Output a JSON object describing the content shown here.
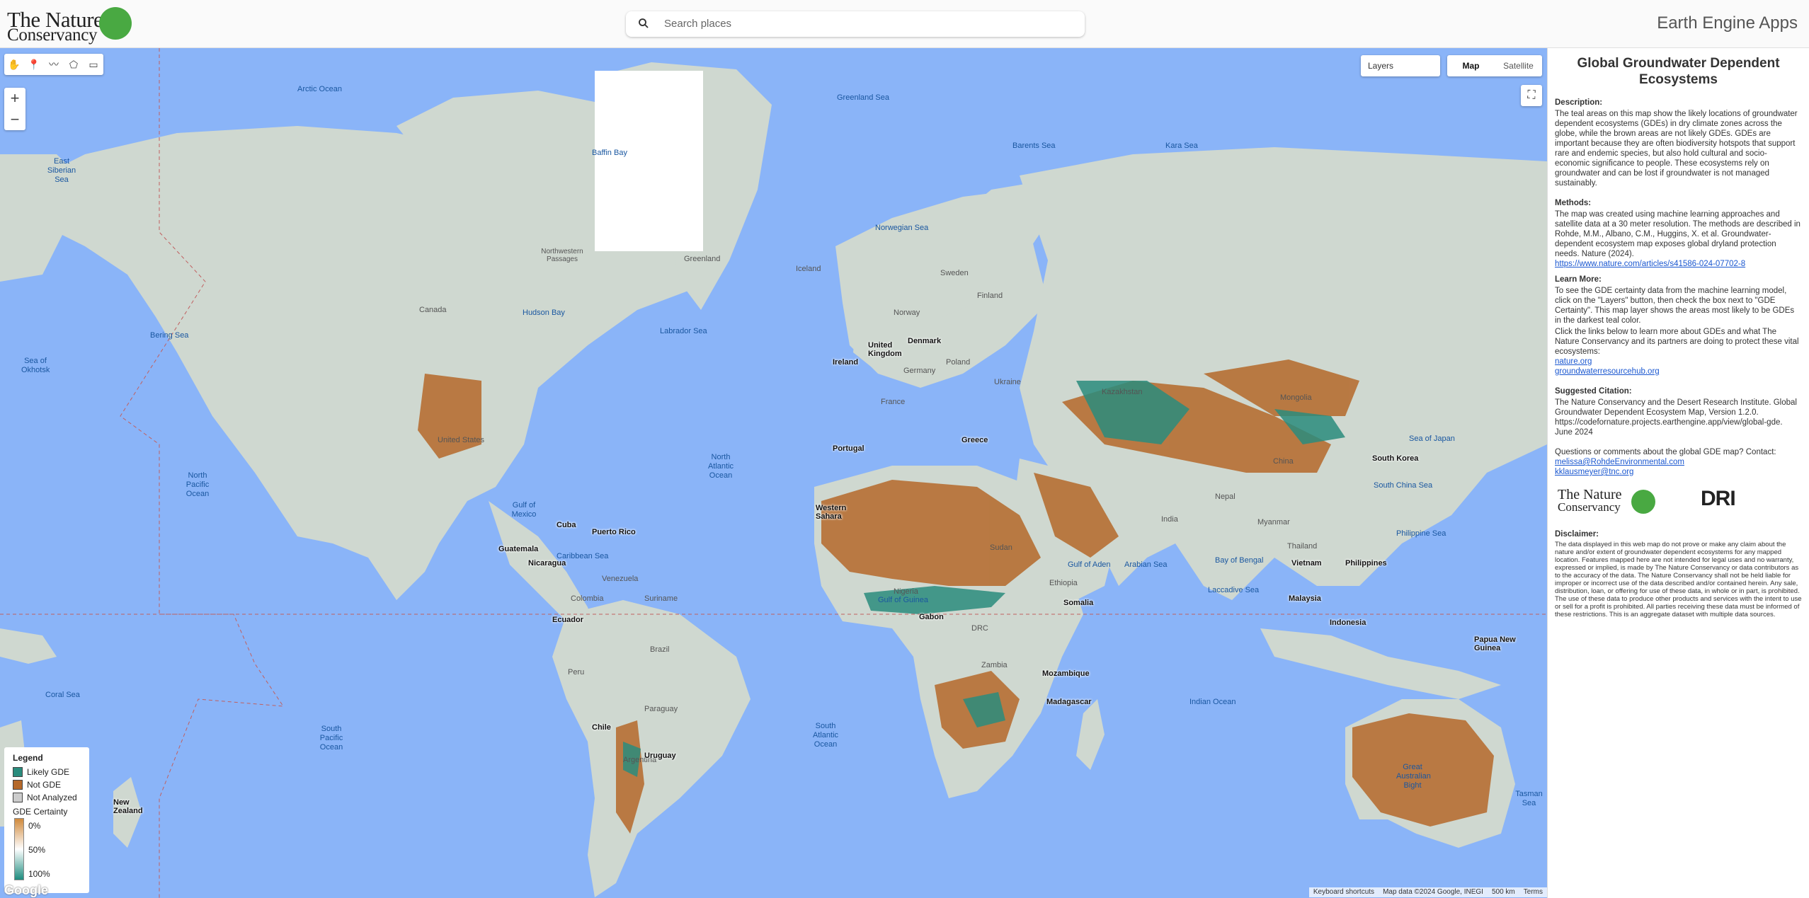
{
  "header": {
    "logo_line1": "The Nature",
    "logo_line2": "Conservancy",
    "search_placeholder": "Search places",
    "app_title": "Earth Engine Apps"
  },
  "map": {
    "tools": [
      "hand-icon",
      "marker-icon",
      "polyline-icon",
      "polygon-icon",
      "rectangle-icon"
    ],
    "zoom_in": "+",
    "zoom_out": "−",
    "layers_label": "Layers",
    "map_type_map": "Map",
    "map_type_satellite": "Satellite",
    "ocean_labels": [
      {
        "text": "Arctic Ocean"
      },
      {
        "text": "North Pacific Ocean"
      },
      {
        "text": "North Atlantic Ocean"
      },
      {
        "text": "South Pacific Ocean"
      },
      {
        "text": "South Atlantic Ocean"
      },
      {
        "text": "Indian Ocean"
      },
      {
        "text": "Greenland Sea"
      },
      {
        "text": "Norwegian Sea"
      },
      {
        "text": "Barents Sea"
      },
      {
        "text": "Kara Sea"
      },
      {
        "text": "Baffin Bay"
      },
      {
        "text": "Hudson Bay"
      },
      {
        "text": "Labrador Sea"
      },
      {
        "text": "Bering Sea"
      },
      {
        "text": "Sea of Okhotsk"
      },
      {
        "text": "East Siberian Sea"
      },
      {
        "text": "Gulf of Mexico"
      },
      {
        "text": "Caribbean Sea"
      },
      {
        "text": "Arabian Sea"
      },
      {
        "text": "Bay of Bengal"
      },
      {
        "text": "Coral Sea"
      },
      {
        "text": "Tasman Sea"
      },
      {
        "text": "Philippine Sea"
      },
      {
        "text": "South China Sea"
      },
      {
        "text": "Sea of Japan"
      },
      {
        "text": "Gulf of Aden"
      },
      {
        "text": "Gulf of Guinea"
      },
      {
        "text": "Great Australian Bight"
      },
      {
        "text": "Laccadive Sea"
      }
    ],
    "place_labels": [
      {
        "text": "Greenland"
      },
      {
        "text": "Iceland"
      },
      {
        "text": "Canada"
      },
      {
        "text": "United States"
      },
      {
        "text": "Sweden"
      },
      {
        "text": "Finland"
      },
      {
        "text": "Norway"
      },
      {
        "text": "Poland"
      },
      {
        "text": "Ukraine"
      },
      {
        "text": "Germany"
      },
      {
        "text": "France"
      },
      {
        "text": "Kazakhstan"
      },
      {
        "text": "Mongolia"
      },
      {
        "text": "China"
      },
      {
        "text": "India"
      },
      {
        "text": "Brazil"
      },
      {
        "text": "Peru"
      },
      {
        "text": "Colombia"
      },
      {
        "text": "Venezuela"
      },
      {
        "text": "Suriname"
      },
      {
        "text": "Paraguay"
      },
      {
        "text": "Argentina"
      },
      {
        "text": "DRC"
      },
      {
        "text": "Zambia"
      },
      {
        "text": "Nigeria"
      },
      {
        "text": "Sudan"
      },
      {
        "text": "Ethiopia"
      },
      {
        "text": "Thailand"
      },
      {
        "text": "Myanmar"
      },
      {
        "text": "Nepal"
      },
      {
        "text": "Northwestern Passages"
      }
    ],
    "city_labels": [
      {
        "text": "United Kingdom"
      },
      {
        "text": "Ireland"
      },
      {
        "text": "Denmark"
      },
      {
        "text": "Portugal"
      },
      {
        "text": "Greece"
      },
      {
        "text": "Cuba"
      },
      {
        "text": "Puerto Rico"
      },
      {
        "text": "Guatemala"
      },
      {
        "text": "Nicaragua"
      },
      {
        "text": "Ecuador"
      },
      {
        "text": "Chile"
      },
      {
        "text": "Uruguay"
      },
      {
        "text": "Gabon"
      },
      {
        "text": "Mozambique"
      },
      {
        "text": "Madagascar"
      },
      {
        "text": "Somalia"
      },
      {
        "text": "South Korea"
      },
      {
        "text": "Vietnam"
      },
      {
        "text": "Philippines"
      },
      {
        "text": "Malaysia"
      },
      {
        "text": "Indonesia"
      },
      {
        "text": "Papua New Guinea"
      },
      {
        "text": "New Zealand"
      },
      {
        "text": "Western Sahara"
      }
    ],
    "legend": {
      "title": "Legend",
      "items": [
        {
          "label": "Likely GDE",
          "color": "#2a8c7d"
        },
        {
          "label": "Not GDE",
          "color": "#b5692a"
        },
        {
          "label": "Not Analyzed",
          "color": "#cccccc"
        }
      ],
      "certainty_title": "GDE Certainty",
      "ticks": [
        "0%",
        "50%",
        "100%"
      ]
    },
    "google_logo": "Google",
    "attribution": {
      "shortcuts": "Keyboard shortcuts",
      "data": "Map data ©2024 Google, INEGI",
      "scale": "500 km",
      "terms": "Terms"
    }
  },
  "panel": {
    "title": "Global Groundwater Dependent Ecosystems",
    "description_head": "Description:",
    "description": "The teal areas on this map show the likely locations of groundwater dependent ecosystems (GDEs) in dry climate zones across the globe, while the brown areas are not likely GDEs. GDEs are important because they are often biodiversity hotspots that support rare and endemic species, but also hold cultural and socio-economic significance to people. These ecosystems rely on groundwater and can be lost if groundwater is not managed sustainably.",
    "methods_head": "Methods:",
    "methods": "The map was created using machine learning approaches and satellite data at a 30 meter resolution. The methods are described in Rohde, M.M., Albano, C.M., Huggins, X. et al. Groundwater-dependent ecosystem map exposes global dryland protection needs. Nature (2024).",
    "methods_link": "https://www.nature.com/articles/s41586-024-07702-8",
    "learn_head": "Learn More:",
    "learn1": "To see the GDE certainty data from the machine learning model, click on the \"Layers\" button, then check the box next to \"GDE Certainty\". This map layer shows the areas most likely to be GDEs in the darkest teal color.",
    "learn2": "Click the links below to learn more about GDEs and what The Nature Conservancy and its partners are doing to protect these vital ecosystems:",
    "link1": "nature.org",
    "link2": "groundwaterresourcehub.org",
    "citation_head": "Suggested Citation:",
    "citation": "The Nature Conservancy and the Desert Research Institute. Global Groundwater Dependent Ecosystem Map, Version 1.2.0. https://codefornature.projects.earthengine.app/view/global-gde. June 2024",
    "contact": "Questions or comments about the global GDE map? Contact:",
    "email1": "melissa@RohdeEnvironmental.com",
    "email2": "kklausmeyer@tnc.org",
    "logo_tnc_line1": "The Nature",
    "logo_tnc_line2": "Conservancy",
    "logo_dri": "DRI",
    "disclaimer_head": "Disclaimer:",
    "disclaimer": "The data displayed in this web map do not prove or make any claim about the nature and/or extent of groundwater dependent ecosystems for any mapped location. Features mapped here are not intended for legal uses and no warranty, expressed or implied, is made by The Nature Conservancy or data contributors as to the accuracy of the data. The Nature Conservancy shall not be held liable for improper or incorrect use of the data described and/or contained herein. Any sale, distribution, loan, or offering for use of these data, in whole or in part, is prohibited. The use of these data to produce other products and services with the intent to use or sell for a profit is prohibited. All parties receiving these data must be informed of these restrictions. This is an aggregate dataset with multiple data sources."
  },
  "colors": {
    "ocean": "#8ab4f8",
    "land": "#cfd8d0",
    "gde": "#2a8c7d",
    "not_gde": "#b5692a",
    "link": "#1a57d0"
  }
}
